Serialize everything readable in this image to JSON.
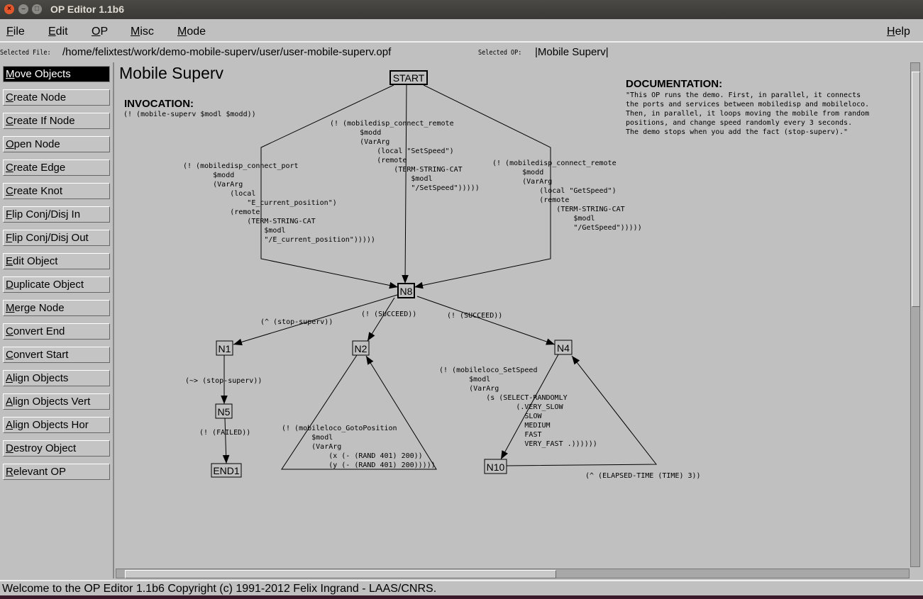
{
  "window": {
    "title": "OP Editor 1.1b6"
  },
  "menu": [
    "File",
    "Edit",
    "OP",
    "Misc",
    "Mode"
  ],
  "help": "Help",
  "filebar": {
    "file_label": "Selected File:",
    "file_value": "/home/felixtest/work/demo-mobile-superv/user/user-mobile-superv.opf",
    "op_label": "Selected OP:",
    "op_value": "|Mobile Superv|"
  },
  "tools": [
    "Move Objects",
    "Create Node",
    "Create If Node",
    "Open Node",
    "Create Edge",
    "Create Knot",
    "Flip Conj/Disj In",
    "Flip Conj/Disj Out",
    "Edit Object",
    "Duplicate Object",
    "Merge Node",
    "Convert End",
    "Convert Start",
    "Align Objects",
    "Align Objects Vert",
    "Align Objects Hor",
    "Destroy Object",
    "Relevant OP"
  ],
  "selected_tool": "Move Objects",
  "op": {
    "title": "Mobile Superv",
    "invocation_heading": "INVOCATION:",
    "invocation": "(! (mobile-superv $modl $modd))",
    "documentation_heading": "DOCUMENTATION:",
    "documentation": [
      "\"This OP runs the demo. First, in parallel, it connects",
      "the ports and services between mobiledisp and mobileloco.",
      "Then, in parallel, it loops moving the mobile from random",
      "positions, and change speed randomly every 3 seconds.",
      "The demo stops when you add the fact (stop-superv).\""
    ],
    "nodes": {
      "start": "START",
      "n8": "N8",
      "n1": "N1",
      "n2": "N2",
      "n4": "N4",
      "n5": "N5",
      "end1": "END1",
      "n10": "N10"
    },
    "edge_labels": {
      "connect_port": [
        "(! (mobiledisp_connect_port",
        "       $modd",
        "       (VarArg",
        "           (local",
        "               \"E_current_position\")",
        "           (remote",
        "               (TERM-STRING-CAT",
        "                   $modl",
        "                   \"/E_current_position\")))))"
      ],
      "connect_setspeed": [
        "(! (mobiledisp_connect_remote",
        "       $modd",
        "       (VarArg",
        "           (local \"SetSpeed\")",
        "           (remote",
        "               (TERM-STRING-CAT",
        "                   $modl",
        "                   \"/SetSpeed\")))))"
      ],
      "connect_getspeed": [
        "(! (mobiledisp_connect_remote",
        "       $modd",
        "       (VarArg",
        "           (local \"GetSpeed\")",
        "           (remote",
        "               (TERM-STRING-CAT",
        "                   $modl",
        "                   \"/GetSpeed\")))))"
      ],
      "wait_stop": [
        "(^ (stop-superv))"
      ],
      "succeed_n2": [
        "(! (SUCCEED))"
      ],
      "succeed_n4": [
        "(! (SUCCEED))"
      ],
      "preserve_stop": [
        "(~> (stop-superv))"
      ],
      "failed": [
        "(! (FAILED))"
      ],
      "goto": [
        "(! (mobileloco_GotoPosition",
        "       $modl",
        "       (VarArg",
        "           (x (- (RAND 401) 200))",
        "           (y (- (RAND 401) 200)))))"
      ],
      "setspeed": [
        "(! (mobileloco_SetSpeed",
        "       $modl",
        "       (VarArg",
        "           (s (SELECT-RANDOMLY",
        "                  (.VERY_SLOW",
        "                    SLOW",
        "                    MEDIUM",
        "                    FAST",
        "                    VERY_FAST .))))))"
      ],
      "elapsed": [
        "(^ (ELAPSED-TIME (TIME) 3))"
      ]
    }
  },
  "status": "Welcome to the OP Editor 1.1b6 Copyright (c) 1991-2012 Felix Ingrand - LAAS/CNRS."
}
